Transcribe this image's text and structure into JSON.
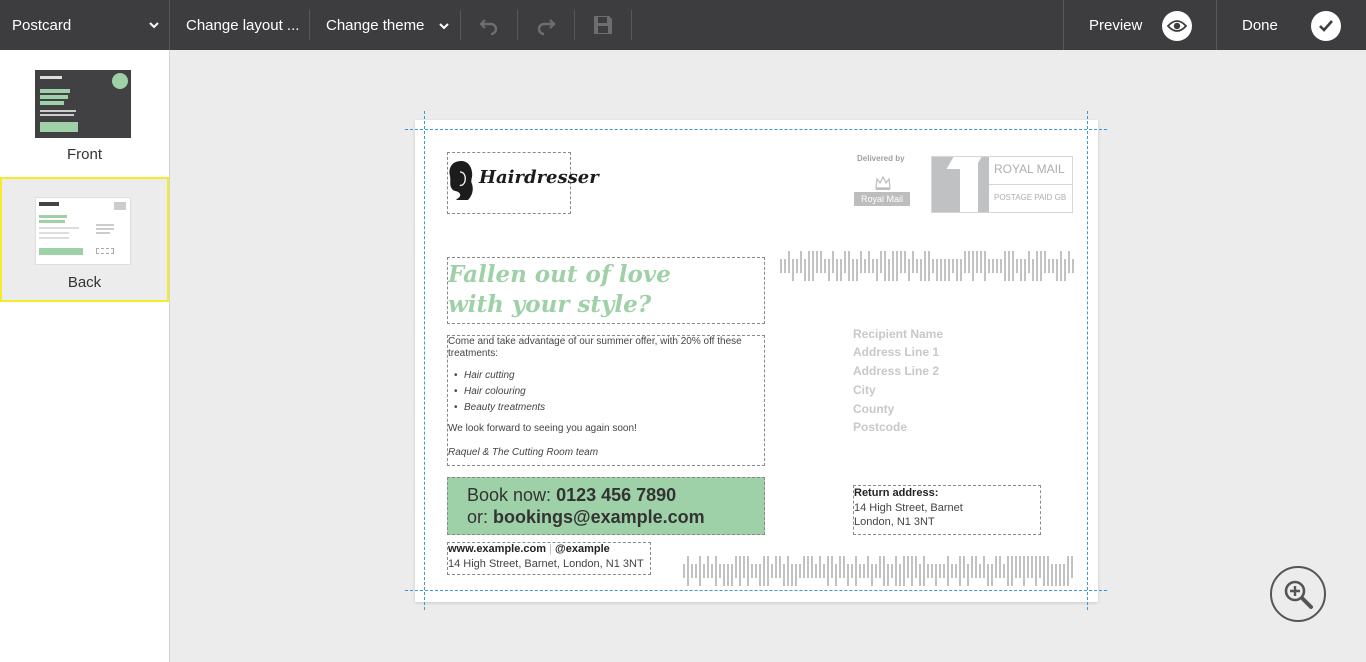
{
  "toolbar": {
    "product_select": "Postcard",
    "change_layout": "Change layout ...",
    "change_theme": "Change theme",
    "preview": "Preview",
    "done": "Done"
  },
  "sidebar": {
    "pages": [
      {
        "label": "Front",
        "selected": false
      },
      {
        "label": "Back",
        "selected": true
      }
    ]
  },
  "postcard": {
    "logo_text": "Hairdresser",
    "postage": {
      "delivered_by": "Delivered by",
      "royal_mail_badge": "Royal Mail",
      "royal_mail": "ROYAL MAIL",
      "postage_paid": "POSTAGE PAID GB"
    },
    "heading_line1": "Fallen out of love",
    "heading_line2": "with your style?",
    "intro": "Come and take advantage of our summer offer, with 20% off these treatments:",
    "bullets": [
      "Hair cutting",
      "Hair colouring",
      "Beauty treatments"
    ],
    "closing": "We look forward to seeing you again soon!",
    "signoff": "Raquel & The Cutting Room team",
    "book_prefix": "Book now: ",
    "book_phone": "0123 456 7890",
    "or_prefix": "or: ",
    "book_email": "bookings@example.com",
    "website": "www.example.com",
    "social": "@example",
    "footer_address": "14 High Street, Barnet, London, N1 3NT",
    "recipient": [
      "Recipient Name",
      "Address Line 1",
      "Address Line 2",
      "City",
      "County",
      "Postcode"
    ],
    "return_title": "Return address:",
    "return_line1": "14 High Street, Barnet",
    "return_line2": "London, N1 3NT"
  },
  "colors": {
    "toolbar_bg": "#3d3d3f",
    "accent_green": "#9fd1a8",
    "selected_border": "#f4ec2a",
    "guide_blue": "#3d97d3"
  }
}
